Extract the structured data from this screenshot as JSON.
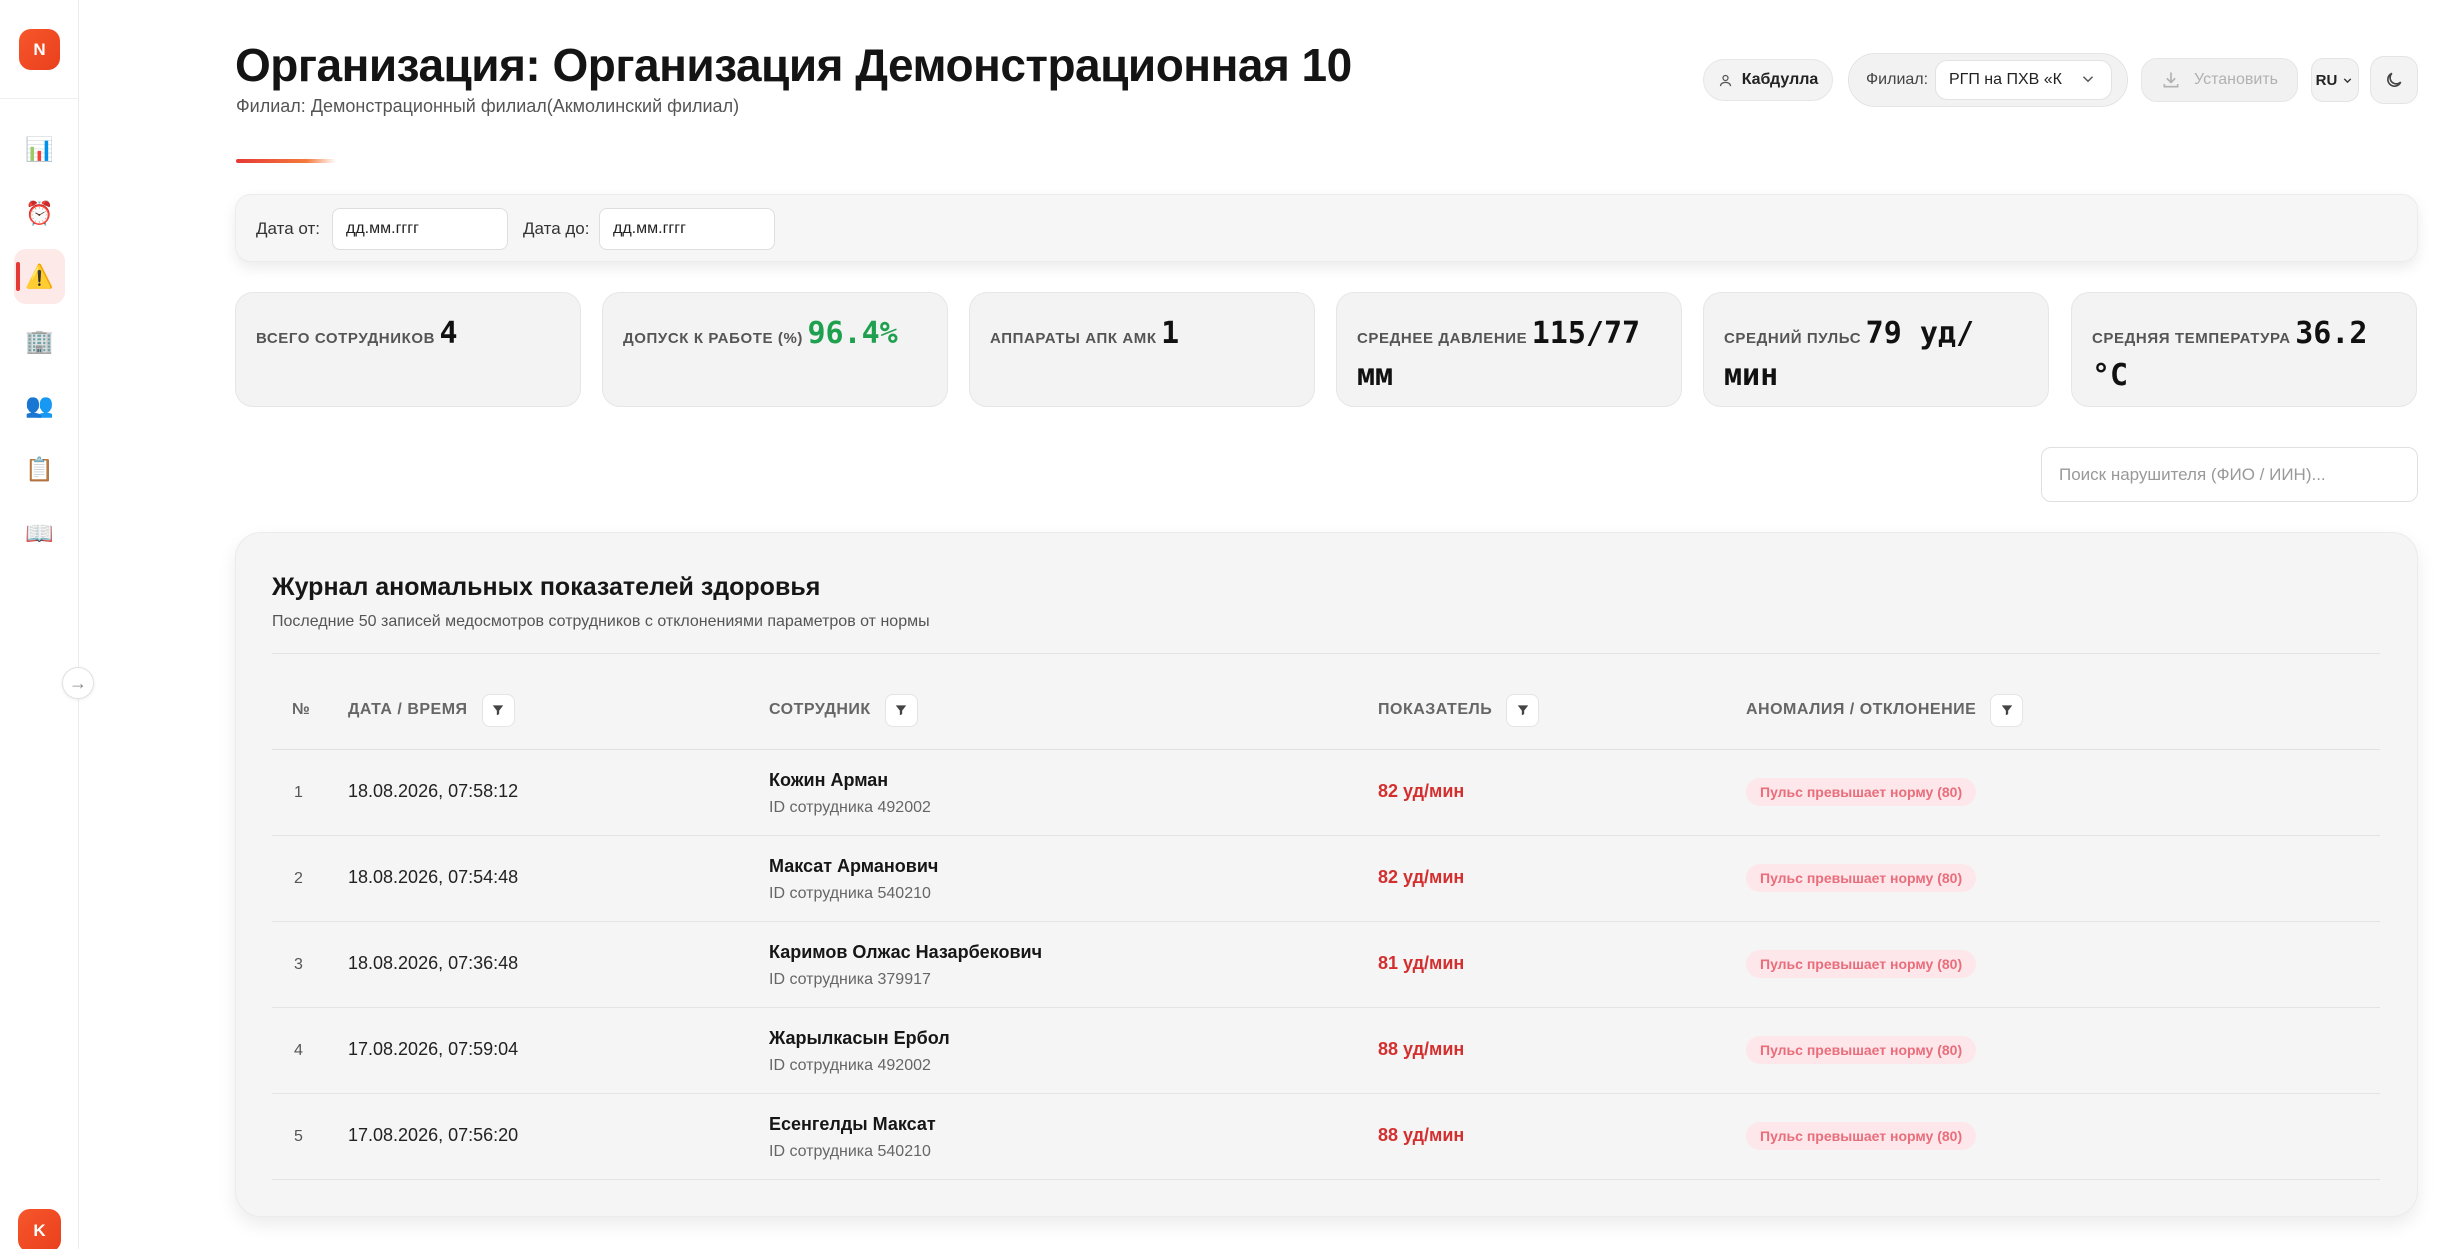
{
  "sidebar": {
    "logo_letter": "N",
    "items": [
      {
        "icon": "📊",
        "name": "dashboard"
      },
      {
        "icon": "⏰",
        "name": "schedule"
      },
      {
        "icon": "⚠️",
        "name": "anomalies"
      },
      {
        "icon": "🏢",
        "name": "organization"
      },
      {
        "icon": "👥",
        "name": "employees"
      },
      {
        "icon": "📋",
        "name": "reports"
      },
      {
        "icon": "📖",
        "name": "guide"
      }
    ],
    "collapse_icon": "→",
    "avatar_letter": "K"
  },
  "header": {
    "title": "Организация: Организация Демонстрационная 10",
    "subtitle": "Филиал: Демонстрационный филиал(Акмолинский филиал)",
    "user_name": "Кабдулла",
    "branch_label": "Филиал:",
    "branch_value": "РГП на ПХВ «К",
    "install_label": "Установить",
    "lang": "RU"
  },
  "filters": {
    "date_from_label": "Дата от:",
    "date_from_placeholder": "дд.мм.гггг",
    "date_to_label": "Дата до:",
    "date_to_placeholder": "дд.мм.гггг"
  },
  "stats": [
    {
      "label": "Всего сотрудников",
      "value": "4"
    },
    {
      "label": "Допуск к работе (%)",
      "value": "96.4%"
    },
    {
      "label": "Аппараты АПК АМК",
      "value": "1"
    },
    {
      "label": "Среднее давление",
      "value": "115/77 мм"
    },
    {
      "label": "Средний пульс",
      "value": "79 уд/мин"
    },
    {
      "label": "Средняя температура",
      "value": "36.2 °C"
    }
  ],
  "search": {
    "placeholder": "Поиск нарушителя (ФИО / ИИН)..."
  },
  "journal": {
    "title": "Журнал аномальных показателей здоровья",
    "subtitle": "Последние 50 записей медосмотров сотрудников с отклонениями параметров от нормы",
    "columns": [
      "№",
      "Дата / Время",
      "Сотрудник",
      "Показатель",
      "Аномалия / Отклонение"
    ],
    "rows": [
      {
        "num": "1",
        "datetime": "18.08.2026, 07:58:12",
        "name": "Кожин Арман",
        "id": "ID сотрудника 492002",
        "value": "82 уд/мин",
        "anomaly": "Пульс превышает норму (80)"
      },
      {
        "num": "2",
        "datetime": "18.08.2026, 07:54:48",
        "name": "Максат Арманович",
        "id": "ID сотрудника 540210",
        "value": "82 уд/мин",
        "anomaly": "Пульс превышает норму (80)"
      },
      {
        "num": "3",
        "datetime": "18.08.2026, 07:36:48",
        "name": "Каримов Олжас Назарбекович",
        "id": "ID сотрудника 379917",
        "value": "81 уд/мин",
        "anomaly": "Пульс превышает норму (80)"
      },
      {
        "num": "4",
        "datetime": "17.08.2026, 07:59:04",
        "name": "Жарылкасын Ербол",
        "id": "ID сотрудника 492002",
        "value": "88 уд/мин",
        "anomaly": "Пульс превышает норму (80)"
      },
      {
        "num": "5",
        "datetime": "17.08.2026, 07:56:20",
        "name": "Есенгелды Максат",
        "id": "ID сотрудника 540210",
        "value": "88 уд/мин",
        "anomaly": "Пульс превышает норму (80)"
      }
    ]
  },
  "colors": {
    "accent": "#e9401c",
    "danger": "#d32f2f",
    "success": "#1ea04f",
    "badge_bg": "#fde7ea"
  }
}
